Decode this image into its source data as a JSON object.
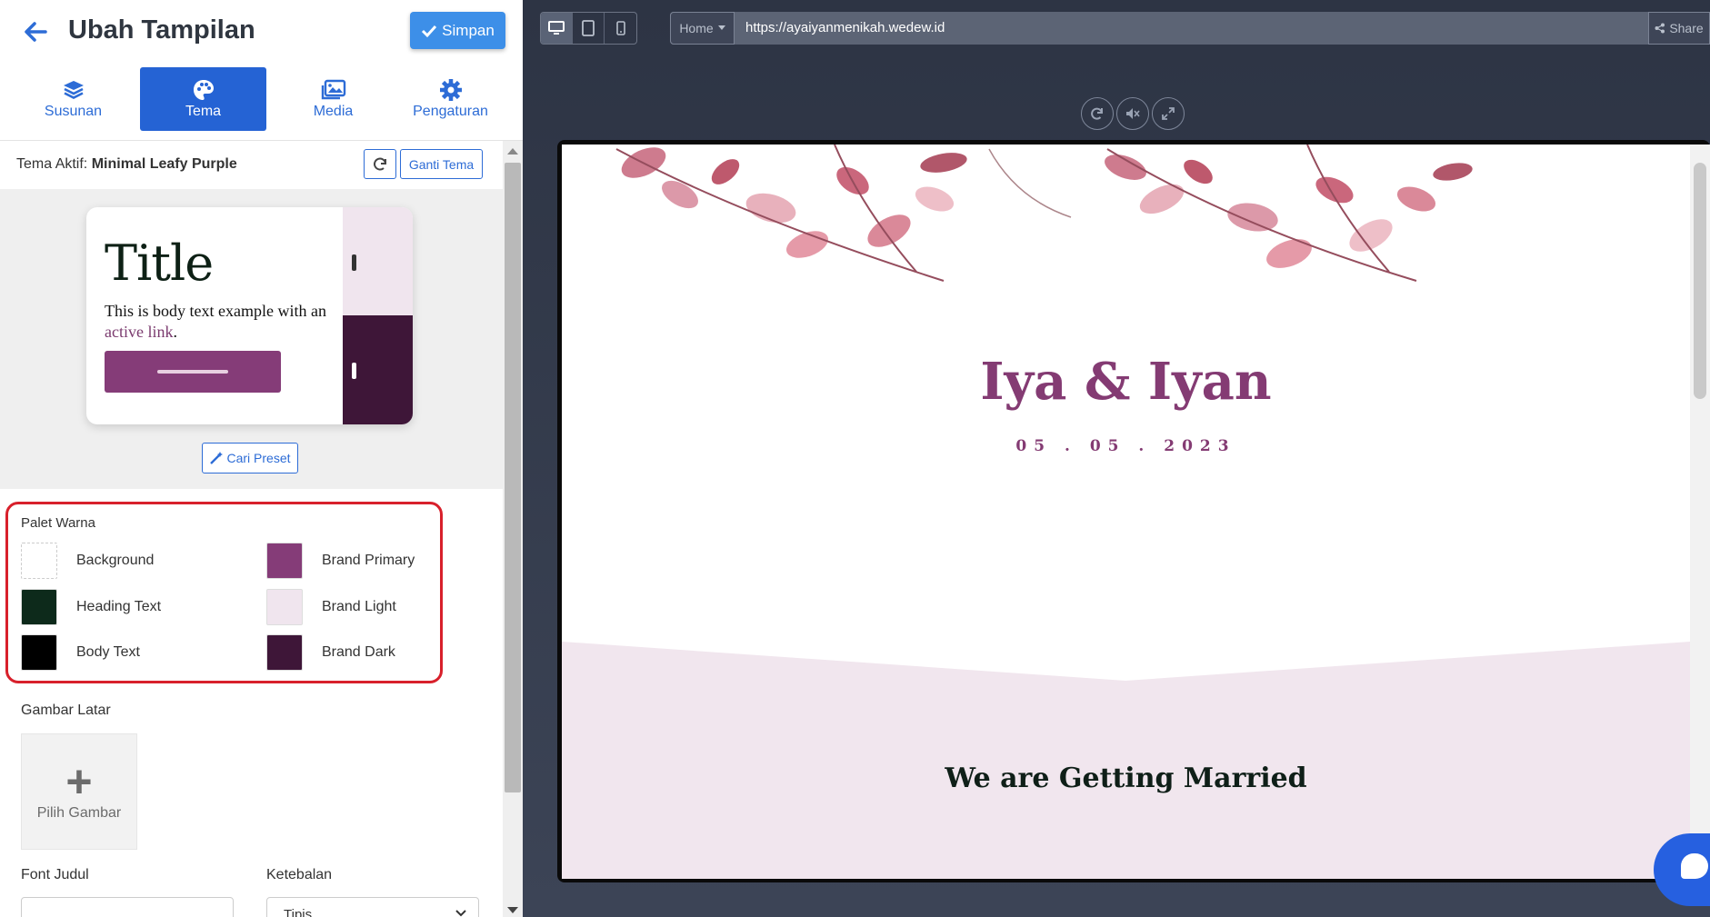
{
  "header": {
    "title": "Ubah Tampilan",
    "save_label": "Simpan"
  },
  "tabs": [
    {
      "label": "Susunan",
      "icon": "layers-icon",
      "active": false
    },
    {
      "label": "Tema",
      "icon": "palette-icon",
      "active": true
    },
    {
      "label": "Media",
      "icon": "images-icon",
      "active": false
    },
    {
      "label": "Pengaturan",
      "icon": "gear-icon",
      "active": false
    }
  ],
  "theme": {
    "active_prefix": "Tema Aktif:",
    "active_name": "Minimal Leafy Purple",
    "change_label": "Ganti Tema",
    "preview_title": "Title",
    "preview_body_before": "This is body text example with an",
    "preview_link": "active link",
    "preview_body_after": ".",
    "preset_label": "Cari Preset"
  },
  "palette": {
    "title": "Palet Warna",
    "items": [
      {
        "label": "Background",
        "color": "#ffffff"
      },
      {
        "label": "Brand Primary",
        "color": "#853c78"
      },
      {
        "label": "Heading Text",
        "color": "#0d2a1b"
      },
      {
        "label": "Brand Light",
        "color": "#f0e5ee"
      },
      {
        "label": "Body Text",
        "color": "#000000"
      },
      {
        "label": "Brand Dark",
        "color": "#3e1638"
      }
    ]
  },
  "background_image": {
    "title": "Gambar Latar",
    "pick_label": "Pilih Gambar"
  },
  "font": {
    "title_label": "Font Judul",
    "weight_label": "Ketebalan",
    "weight_value": "Tipis"
  },
  "preview_toolbar": {
    "home_label": "Home",
    "url": "https://ayaiyanmenikah.wedew.id",
    "share_label": "Share"
  },
  "site": {
    "couple": "Iya & Iyan",
    "date": "05 . 05 . 2023",
    "married": "We are Getting Married"
  },
  "colors": {
    "accent": "#2563d4",
    "highlight_border": "#d8202b",
    "brand_primary": "#853c78"
  }
}
